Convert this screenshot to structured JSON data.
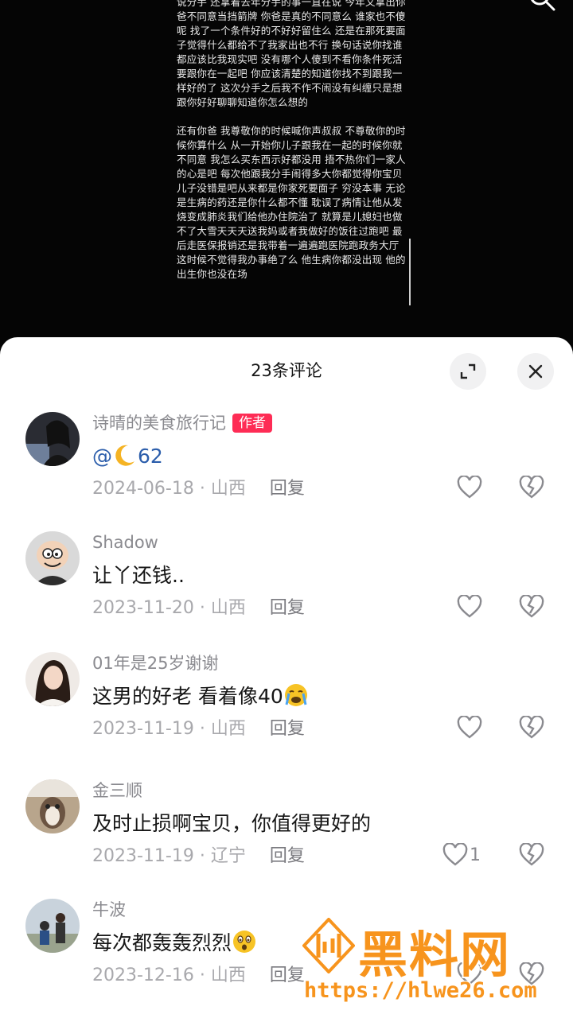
{
  "video": {
    "paragraphs": [
      "说分手 还拿着去年分手的事一直在说 今年又拿出你爸不同意当挡箭牌 你爸是真的不同意么 谁家也不傻呢 找了一个条件好的不好好留住么 还是在那死要面子觉得什么都给不了我家出也不行 换句话说你找谁都应该比我现实吧 没有哪个人傻到不看你条件死活要跟你在一起吧 你应该清楚的知道你找不到跟我一样好的了 这次分手之后我不作不闹没有纠缠只是想跟你好好聊聊知道你怎么想的",
      "还有你爸 我尊敬你的时候喊你声叔叔 不尊敬你的时候你算什么 从一开始你儿子跟我在一起的时候你就不同意 我怎么买东西示好都没用 捂不热你们一家人的心是吧 每次他跟我分手闹得多大你都觉得你宝贝儿子没错是吧从来都是你家死要面子 穷没本事 无论是生病的药还是你什么都不懂 耽误了病情让他从发烧变成肺炎我们给他办住院治了 就算是儿媳妇也做不了大雪天天天送我妈或者我做好的饭往过跑吧 最后走医保报销还是我带着一遍遍跑医院跑政务大厅 这时候不觉得我办事绝了么 他生病你都没出现 他的出生你也没在场"
    ]
  },
  "sheet": {
    "title": "23条评论",
    "expand_icon": "expand-icon",
    "close_icon": "close-icon"
  },
  "comments": [
    {
      "username": "诗晴的美食旅行记",
      "tag": "作者",
      "mention": "@",
      "text_after_emoji": "62",
      "emoji": "crescent-moon",
      "date": "2024-06-18",
      "location": "山西",
      "reply": "回复",
      "likes": ""
    },
    {
      "username": "Shadow",
      "text": "让丫还钱..",
      "date": "2023-11-20",
      "location": "山西",
      "reply": "回复",
      "likes": ""
    },
    {
      "username": "01年是25岁谢谢",
      "text": "这男的好老 看着像40",
      "emoji": "crying-face",
      "date": "2023-11-19",
      "location": "山西",
      "reply": "回复",
      "likes": ""
    },
    {
      "username": "金三顺",
      "text": "及时止损啊宝贝，你值得更好的",
      "date": "2023-11-19",
      "location": "辽宁",
      "reply": "回复",
      "likes": "1"
    },
    {
      "username": "牛波",
      "text": "每次都轰轰烈烈",
      "emoji": "shocked-face",
      "date": "2023-12-16",
      "location": "山西",
      "reply": "回复",
      "likes": ""
    }
  ],
  "meta_separator": " · ",
  "watermark": {
    "title": "黑料网",
    "url": "https://hlwe26.com"
  },
  "colors": {
    "accent": "#fe2c55",
    "mention": "#2b5dab",
    "watermark": "#f7941d"
  }
}
